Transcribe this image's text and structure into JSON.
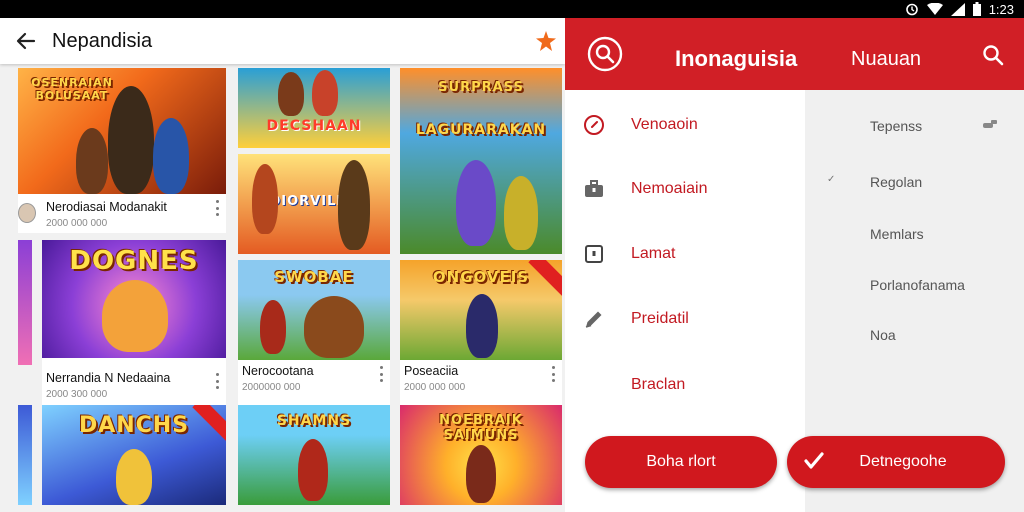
{
  "status_bar": {
    "time": "1:23",
    "icons": [
      "alarm-icon",
      "wifi-icon",
      "signal-icon",
      "battery-icon"
    ]
  },
  "app_bar": {
    "title": "Nepandisia",
    "back_icon": "arrow-back-icon",
    "action_icon": "star-icon"
  },
  "games": [
    {
      "art_title": "OSENRAIAN BOLUSAAT",
      "name": "Nerodiasai Modanakit",
      "sub": "2000 000 000",
      "colors": [
        "#f26a1b",
        "#7a1c0a"
      ]
    },
    {
      "art_title": "DOGNES",
      "name": "Nerrandia N Nedaaina",
      "sub": "2000 300 000",
      "colors": [
        "#8b3fd6",
        "#f06fb4"
      ]
    },
    {
      "art_title": "DANCHS",
      "name": "",
      "sub": "",
      "colors": [
        "#3d5ad6",
        "#7fd1ff"
      ]
    },
    {
      "art_title": "DECSHAAN",
      "name": "",
      "sub": "",
      "colors": [
        "#2a9fd6",
        "#ffcf3a"
      ]
    },
    {
      "art_title": "DIORVILDS",
      "name": "",
      "sub": "",
      "colors": [
        "#ffd84a",
        "#e45b22"
      ]
    },
    {
      "art_title": "SWOBAE",
      "name": "Nerocootana",
      "sub": "2000000 000",
      "colors": [
        "#8bc9f0",
        "#5aa83a"
      ]
    },
    {
      "art_title": "SHAMNS",
      "name": "",
      "sub": "",
      "colors": [
        "#6dcff6",
        "#3a9c3a"
      ]
    },
    {
      "art_title": "SURPRASS",
      "name": "",
      "sub": "",
      "colors": [
        "#5ac1f5",
        "#4b8a2a"
      ]
    },
    {
      "art_title": "LAGURARAKAN",
      "name": "",
      "sub": "",
      "colors": [
        "#4fa8e0",
        "#ff8f2a"
      ]
    },
    {
      "art_title": "ONGOVEIS",
      "name": "Poseaciia",
      "sub": "2000 000 000",
      "colors": [
        "#f5a32a",
        "#6ca834"
      ]
    },
    {
      "art_title": "NOEBRAIK SAIMUNS",
      "name": "",
      "sub": "",
      "colors": [
        "#d92a6c",
        "#ffb02a"
      ]
    }
  ],
  "drawer": {
    "header_title": "Inonaguisia",
    "header_subtitle": "Nuauan",
    "accent_color": "#d11f26",
    "menu": [
      {
        "label": "Venoaoin",
        "icon": "compass-icon"
      },
      {
        "label": "Nemoaiain",
        "icon": "briefcase-icon"
      },
      {
        "label": "Lamat",
        "icon": "square-icon"
      },
      {
        "label": "Preidatil",
        "icon": "pencil-icon"
      },
      {
        "label": "Braclan",
        "icon": ""
      }
    ],
    "filters": [
      {
        "label": "Tepenss",
        "checked": false
      },
      {
        "label": "Regolan",
        "checked": true
      },
      {
        "label": "Memlars",
        "checked": false
      },
      {
        "label": "Porlanofanama",
        "checked": false
      },
      {
        "label": "Noa",
        "checked": false
      }
    ],
    "button_left": "Boha rlort",
    "button_right": "Detnegoohe"
  }
}
